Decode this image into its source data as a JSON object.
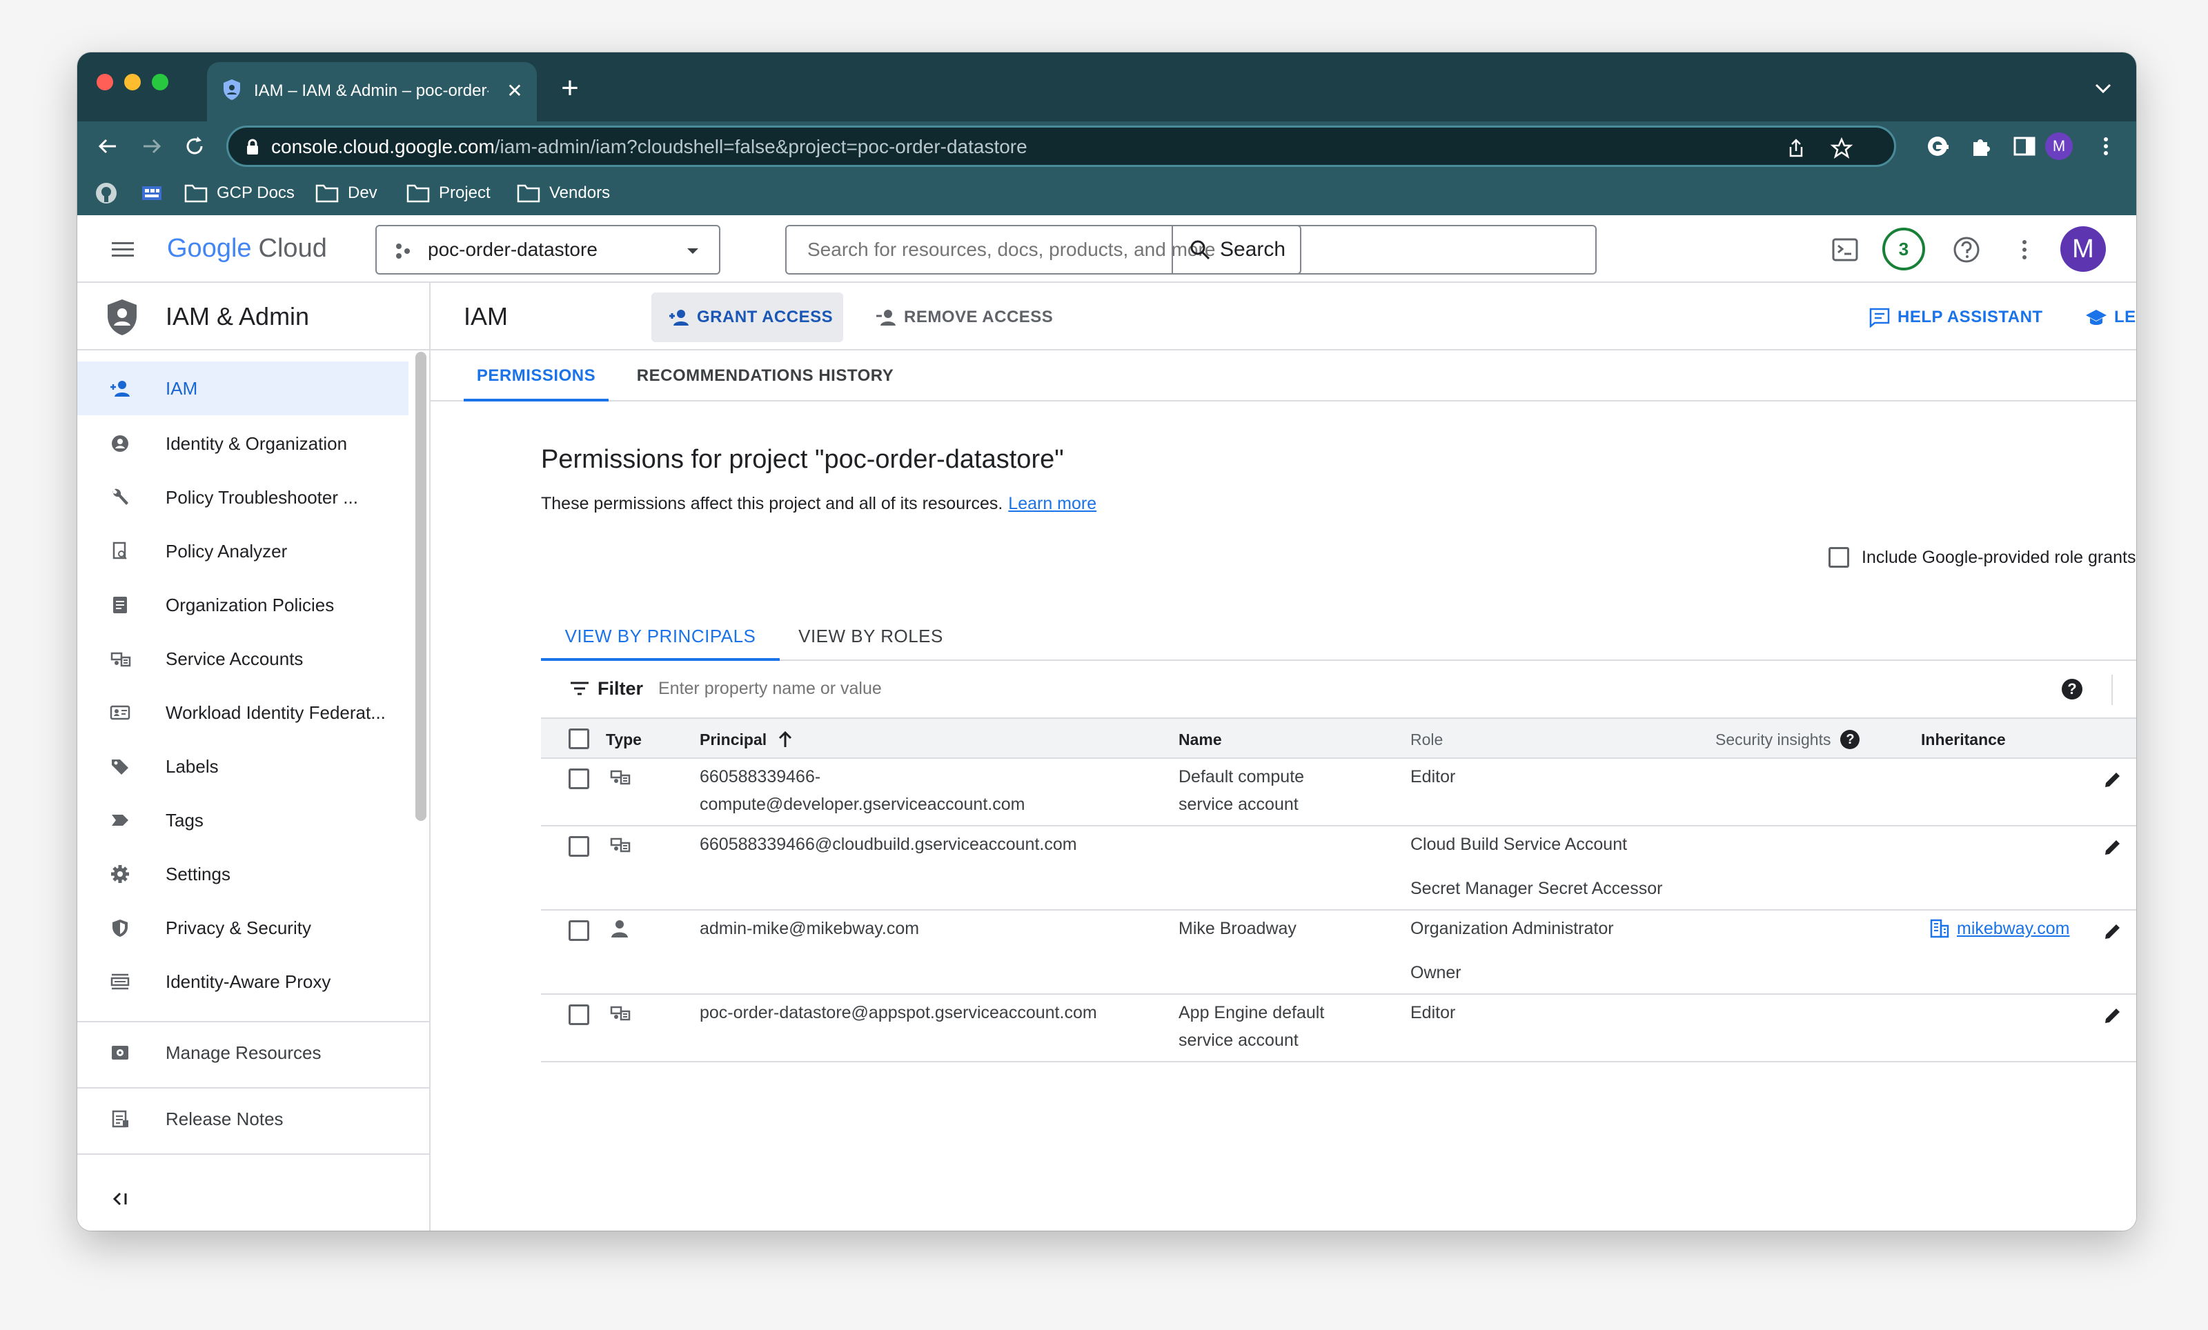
{
  "browser": {
    "tab_title": "IAM – IAM & Admin – poc-order-datastore",
    "tab_close": "✕",
    "new_tab": "+",
    "url_host": "console.cloud.google.com",
    "url_path": "/iam-admin/iam?cloudshell=false&project=poc-order-datastore",
    "profile_initial": "M",
    "bookmarks": [
      "GCP Docs",
      "Dev",
      "Project",
      "Vendors"
    ]
  },
  "header": {
    "logo_google": "Google",
    "logo_cloud": "Cloud",
    "project": "poc-order-datastore",
    "search_placeholder": "Search for resources, docs, products, and more",
    "search_button": "Search",
    "notifications_count": "3",
    "avatar_initial": "M"
  },
  "sidebar": {
    "title": "IAM & Admin",
    "items": [
      {
        "label": "IAM"
      },
      {
        "label": "Identity & Organization"
      },
      {
        "label": "Policy Troubleshooter ..."
      },
      {
        "label": "Policy Analyzer"
      },
      {
        "label": "Organization Policies"
      },
      {
        "label": "Service Accounts"
      },
      {
        "label": "Workload Identity Federat..."
      },
      {
        "label": "Labels"
      },
      {
        "label": "Tags"
      },
      {
        "label": "Settings"
      },
      {
        "label": "Privacy & Security"
      },
      {
        "label": "Identity-Aware Proxy"
      }
    ],
    "manage_resources": "Manage Resources",
    "release_notes": "Release Notes",
    "collapse": "<I"
  },
  "main": {
    "title": "IAM",
    "grant_access": "GRANT ACCESS",
    "remove_access": "REMOVE ACCESS",
    "help_assistant": "HELP ASSISTANT",
    "learn": "LEARN",
    "tabs": [
      "PERMISSIONS",
      "RECOMMENDATIONS HISTORY"
    ],
    "heading": "Permissions for project \"poc-order-datastore\"",
    "subtext": "These permissions affect this project and all of its resources.",
    "learn_more": "Learn more",
    "include_google": "Include Google-provided role grants",
    "view_tabs": [
      "VIEW BY PRINCIPALS",
      "VIEW BY ROLES"
    ],
    "filter_label": "Filter",
    "filter_placeholder": "Enter property name or value",
    "help_glyph": "?"
  },
  "table": {
    "columns": {
      "type": "Type",
      "principal": "Principal",
      "name": "Name",
      "role": "Role",
      "security": "Security insights",
      "inheritance": "Inheritance"
    },
    "rows": [
      {
        "type": "service-account",
        "principal_l1": "660588339466-",
        "principal_l2": "compute@developer.gserviceaccount.com",
        "name_l1": "Default compute",
        "name_l2": "service account",
        "role_l1": "Editor",
        "role_l2": "",
        "inheritance": ""
      },
      {
        "type": "service-account",
        "principal_l1": "660588339466@cloudbuild.gserviceaccount.com",
        "principal_l2": "",
        "name_l1": "",
        "name_l2": "",
        "role_l1": "Cloud Build Service Account",
        "role_l2": "Secret Manager Secret Accessor",
        "inheritance": ""
      },
      {
        "type": "user",
        "principal_l1": "admin-mike@mikebway.com",
        "principal_l2": "",
        "name_l1": "Mike Broadway",
        "name_l2": "",
        "role_l1": "Organization Administrator",
        "role_l2": "Owner",
        "inheritance": "mikebway.com"
      },
      {
        "type": "service-account",
        "principal_l1": "poc-order-datastore@appspot.gserviceaccount.com",
        "principal_l2": "",
        "name_l1": "App Engine default",
        "name_l2": "service account",
        "role_l1": "Editor",
        "role_l2": "",
        "inheritance": ""
      }
    ]
  },
  "colors": {
    "chrome_frame": "#1d3f48",
    "chrome_toolbar": "#2b5a64",
    "accent": "#1a73e8",
    "active_nav_bg": "#e8f0fe"
  }
}
